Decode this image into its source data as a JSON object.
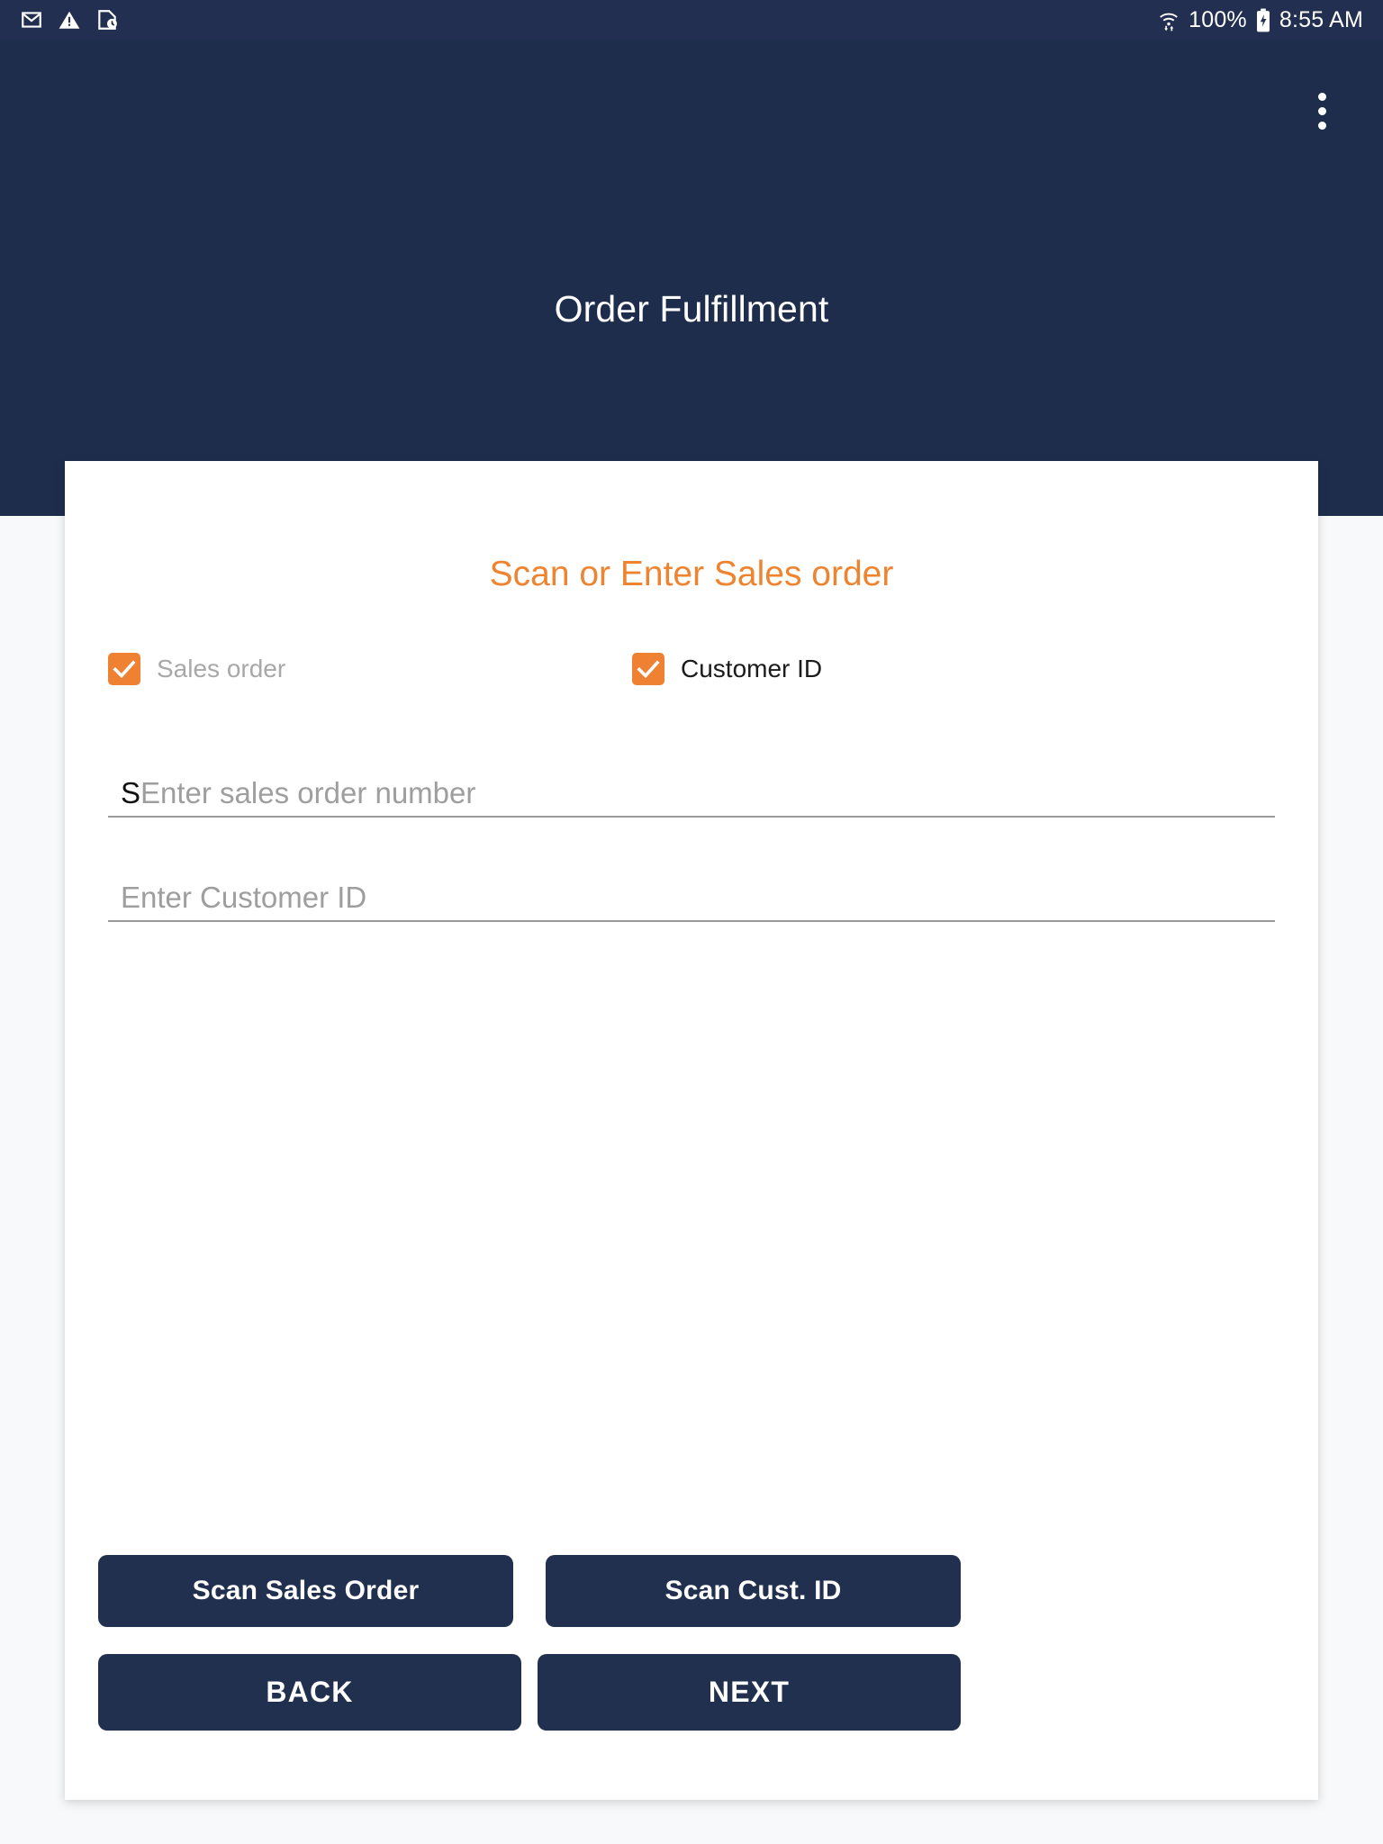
{
  "status_bar": {
    "icons_left": [
      "mail-icon",
      "warning-icon",
      "document-clock-icon"
    ],
    "wifi_icon": "wifi-updown-icon",
    "battery_percent": "100%",
    "battery_icon": "battery-charging-icon",
    "time": "8:55 AM"
  },
  "appbar": {
    "title": "Order Fulfillment",
    "overflow_menu": "more-vert-icon"
  },
  "card": {
    "heading": "Scan or Enter Sales order",
    "checkboxes": [
      {
        "label": "Sales order",
        "checked": true,
        "enabled": false
      },
      {
        "label": "Customer ID",
        "checked": true,
        "enabled": true
      }
    ],
    "fields": [
      {
        "name": "sales-order",
        "value": "S",
        "placeholder": "Enter sales order number"
      },
      {
        "name": "customer-id",
        "value": "",
        "placeholder": "Enter Customer ID"
      }
    ],
    "scan_buttons": [
      {
        "label": "Scan Sales Order"
      },
      {
        "label": "Scan Cust. ID"
      }
    ],
    "nav_buttons": [
      {
        "label": "BACK"
      },
      {
        "label": "NEXT"
      }
    ]
  },
  "colors": {
    "navy": "#1f2d4d",
    "status_bar_navy": "#222f50",
    "orange": "#ef8430",
    "checkbox_orange": "#ee8132",
    "button_navy": "#22304f",
    "page_background": "#f8f9fa",
    "card_background": "#ffffff",
    "placeholder_gray": "#9e9e9e",
    "disabled_label_gray": "#a8a8a8"
  }
}
